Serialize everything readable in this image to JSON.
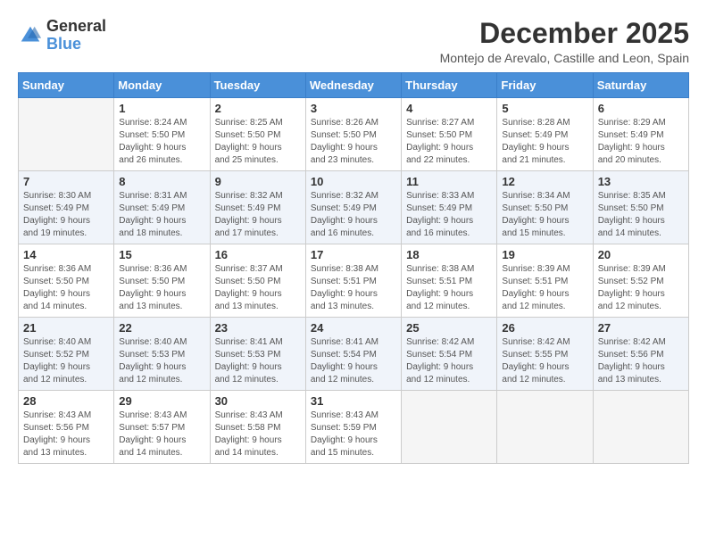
{
  "logo": {
    "general": "General",
    "blue": "Blue"
  },
  "title": "December 2025",
  "subtitle": "Montejo de Arevalo, Castille and Leon, Spain",
  "weekdays": [
    "Sunday",
    "Monday",
    "Tuesday",
    "Wednesday",
    "Thursday",
    "Friday",
    "Saturday"
  ],
  "weeks": [
    [
      {
        "day": "",
        "info": ""
      },
      {
        "day": "1",
        "info": "Sunrise: 8:24 AM\nSunset: 5:50 PM\nDaylight: 9 hours\nand 26 minutes."
      },
      {
        "day": "2",
        "info": "Sunrise: 8:25 AM\nSunset: 5:50 PM\nDaylight: 9 hours\nand 25 minutes."
      },
      {
        "day": "3",
        "info": "Sunrise: 8:26 AM\nSunset: 5:50 PM\nDaylight: 9 hours\nand 23 minutes."
      },
      {
        "day": "4",
        "info": "Sunrise: 8:27 AM\nSunset: 5:50 PM\nDaylight: 9 hours\nand 22 minutes."
      },
      {
        "day": "5",
        "info": "Sunrise: 8:28 AM\nSunset: 5:49 PM\nDaylight: 9 hours\nand 21 minutes."
      },
      {
        "day": "6",
        "info": "Sunrise: 8:29 AM\nSunset: 5:49 PM\nDaylight: 9 hours\nand 20 minutes."
      }
    ],
    [
      {
        "day": "7",
        "info": "Sunrise: 8:30 AM\nSunset: 5:49 PM\nDaylight: 9 hours\nand 19 minutes."
      },
      {
        "day": "8",
        "info": "Sunrise: 8:31 AM\nSunset: 5:49 PM\nDaylight: 9 hours\nand 18 minutes."
      },
      {
        "day": "9",
        "info": "Sunrise: 8:32 AM\nSunset: 5:49 PM\nDaylight: 9 hours\nand 17 minutes."
      },
      {
        "day": "10",
        "info": "Sunrise: 8:32 AM\nSunset: 5:49 PM\nDaylight: 9 hours\nand 16 minutes."
      },
      {
        "day": "11",
        "info": "Sunrise: 8:33 AM\nSunset: 5:49 PM\nDaylight: 9 hours\nand 16 minutes."
      },
      {
        "day": "12",
        "info": "Sunrise: 8:34 AM\nSunset: 5:50 PM\nDaylight: 9 hours\nand 15 minutes."
      },
      {
        "day": "13",
        "info": "Sunrise: 8:35 AM\nSunset: 5:50 PM\nDaylight: 9 hours\nand 14 minutes."
      }
    ],
    [
      {
        "day": "14",
        "info": "Sunrise: 8:36 AM\nSunset: 5:50 PM\nDaylight: 9 hours\nand 14 minutes."
      },
      {
        "day": "15",
        "info": "Sunrise: 8:36 AM\nSunset: 5:50 PM\nDaylight: 9 hours\nand 13 minutes."
      },
      {
        "day": "16",
        "info": "Sunrise: 8:37 AM\nSunset: 5:50 PM\nDaylight: 9 hours\nand 13 minutes."
      },
      {
        "day": "17",
        "info": "Sunrise: 8:38 AM\nSunset: 5:51 PM\nDaylight: 9 hours\nand 13 minutes."
      },
      {
        "day": "18",
        "info": "Sunrise: 8:38 AM\nSunset: 5:51 PM\nDaylight: 9 hours\nand 12 minutes."
      },
      {
        "day": "19",
        "info": "Sunrise: 8:39 AM\nSunset: 5:51 PM\nDaylight: 9 hours\nand 12 minutes."
      },
      {
        "day": "20",
        "info": "Sunrise: 8:39 AM\nSunset: 5:52 PM\nDaylight: 9 hours\nand 12 minutes."
      }
    ],
    [
      {
        "day": "21",
        "info": "Sunrise: 8:40 AM\nSunset: 5:52 PM\nDaylight: 9 hours\nand 12 minutes."
      },
      {
        "day": "22",
        "info": "Sunrise: 8:40 AM\nSunset: 5:53 PM\nDaylight: 9 hours\nand 12 minutes."
      },
      {
        "day": "23",
        "info": "Sunrise: 8:41 AM\nSunset: 5:53 PM\nDaylight: 9 hours\nand 12 minutes."
      },
      {
        "day": "24",
        "info": "Sunrise: 8:41 AM\nSunset: 5:54 PM\nDaylight: 9 hours\nand 12 minutes."
      },
      {
        "day": "25",
        "info": "Sunrise: 8:42 AM\nSunset: 5:54 PM\nDaylight: 9 hours\nand 12 minutes."
      },
      {
        "day": "26",
        "info": "Sunrise: 8:42 AM\nSunset: 5:55 PM\nDaylight: 9 hours\nand 12 minutes."
      },
      {
        "day": "27",
        "info": "Sunrise: 8:42 AM\nSunset: 5:56 PM\nDaylight: 9 hours\nand 13 minutes."
      }
    ],
    [
      {
        "day": "28",
        "info": "Sunrise: 8:43 AM\nSunset: 5:56 PM\nDaylight: 9 hours\nand 13 minutes."
      },
      {
        "day": "29",
        "info": "Sunrise: 8:43 AM\nSunset: 5:57 PM\nDaylight: 9 hours\nand 14 minutes."
      },
      {
        "day": "30",
        "info": "Sunrise: 8:43 AM\nSunset: 5:58 PM\nDaylight: 9 hours\nand 14 minutes."
      },
      {
        "day": "31",
        "info": "Sunrise: 8:43 AM\nSunset: 5:59 PM\nDaylight: 9 hours\nand 15 minutes."
      },
      {
        "day": "",
        "info": ""
      },
      {
        "day": "",
        "info": ""
      },
      {
        "day": "",
        "info": ""
      }
    ]
  ]
}
